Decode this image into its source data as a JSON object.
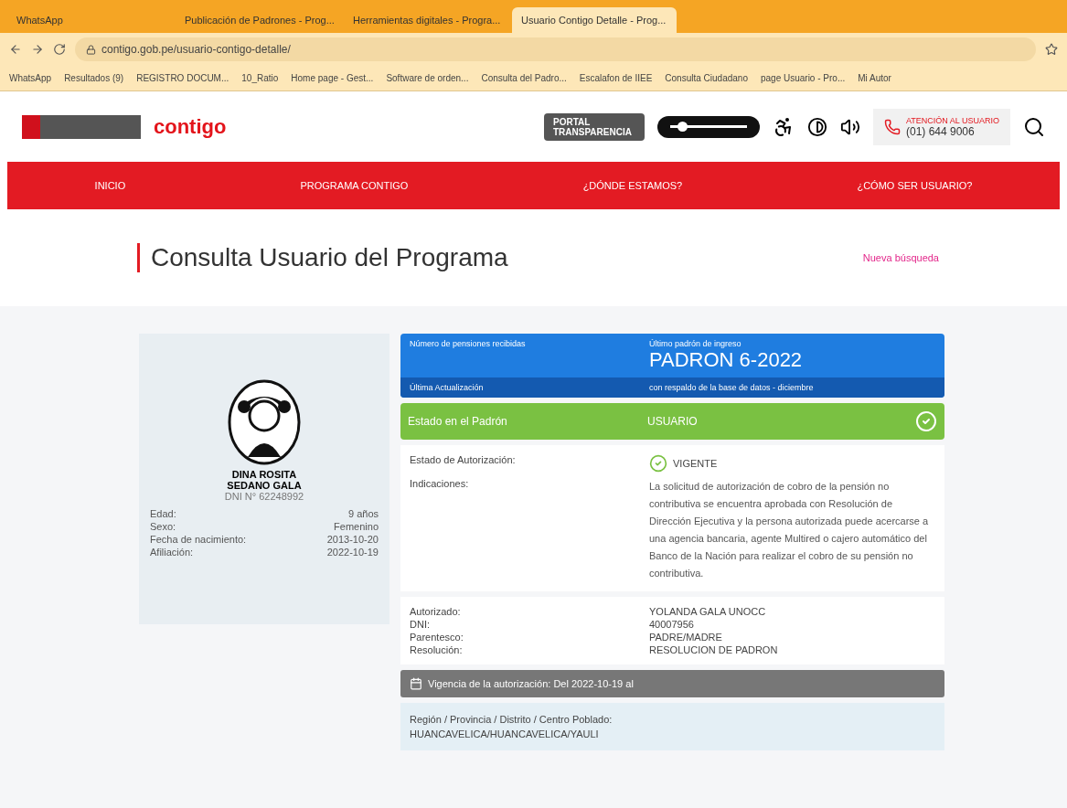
{
  "browser": {
    "tabs": [
      {
        "label": "WhatsApp",
        "selected": false
      },
      {
        "label": "Publicación de Padrones - Prog...",
        "selected": false
      },
      {
        "label": "Herramientas digitales - Progra...",
        "selected": false
      },
      {
        "label": "Usuario Contigo Detalle - Prog...",
        "selected": true
      }
    ],
    "url": "contigo.gob.pe/usuario-contigo-detalle/",
    "bookmarks": [
      "WhatsApp",
      "Resultados (9)",
      "REGISTRO DOCUM...",
      "10_Ratio",
      "Home page - Gest...",
      "Software de orden...",
      "Consulta del Padro...",
      "Escalafon de IIEE",
      "Consulta Ciudadano",
      "page Usuario - Pro...",
      "Mi Autor"
    ]
  },
  "header": {
    "logo": "contigo",
    "portal": "PORTAL TRANSPARENCIA",
    "zoom": {
      "level": 0.15
    },
    "support_label": "ATENCIÓN AL USUARIO",
    "support_phone": "(01) 644 9006"
  },
  "nav": [
    "INICIO",
    "PROGRAMA CONTIGO",
    "¿DÓNDE ESTAMOS?",
    "¿CÓMO SER USUARIO?"
  ],
  "title": "Consulta Usuario del Programa",
  "new_search": "Nueva búsqueda",
  "profile": {
    "name": "DINA ROSITA SEDANO GALA",
    "dni": "DNI N° 62248992",
    "fields": [
      {
        "label": "Edad:",
        "value": "9 años"
      },
      {
        "label": "Sexo:",
        "value": "Femenino"
      },
      {
        "label": "Fecha de nacimiento:",
        "value": "2013-10-20"
      },
      {
        "label": "Afiliación:",
        "value": "2022-10-19"
      }
    ]
  },
  "summary": {
    "left_label": "Número de pensiones recibidas",
    "right_label": "Último padrón de ingreso",
    "padron": "PADRON 6-2022",
    "update_label": "Última Actualización",
    "update_value": "con respaldo de la base de datos - diciembre"
  },
  "status": {
    "label": "Estado en el Padrón",
    "value": "USUARIO"
  },
  "authorization": {
    "label": "Estado de Autorización:",
    "value": "VIGENTE",
    "notes_label": "Indicaciones:",
    "notes": "La solicitud de autorización de cobro de la pensión no contributiva se encuentra aprobada con Resolución de Dirección Ejecutiva y la persona autorizada puede acercarse a una agencia bancaria, agente Multired o cajero automático del Banco de la Nación para realizar el cobro de su pensión no contributiva."
  },
  "authorized": [
    {
      "label": "Autorizado:",
      "value": "YOLANDA GALA UNOCC"
    },
    {
      "label": "DNI:",
      "value": "40007956"
    },
    {
      "label": "Parentesco:",
      "value": "PADRE/MADRE"
    },
    {
      "label": "Resolución:",
      "value": "RESOLUCION DE PADRON"
    }
  ],
  "validity": "Vigencia de la autorización: Del 2022-10-19 al",
  "location": {
    "label": "Región / Provincia / Distrito / Centro Poblado:",
    "value": "HUANCAVELICA/HUANCAVELICA/YAULI"
  }
}
